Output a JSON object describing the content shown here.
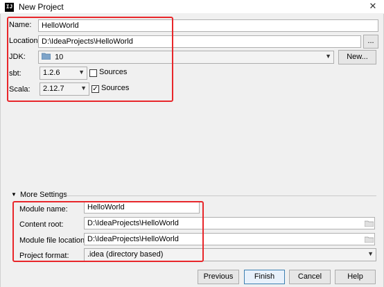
{
  "window": {
    "title": "New Project",
    "icon_label": "IJ",
    "close_label": "✕"
  },
  "form": {
    "name_label": "Name:",
    "name_value": "HelloWorld",
    "location_label": "Location:",
    "location_value": "D:\\IdeaProjects\\HelloWorld",
    "browse_label": "...",
    "jdk_label": "JDK:",
    "jdk_value": "10",
    "new_button_label": "New...",
    "sbt_label": "sbt:",
    "sbt_value": "1.2.6",
    "sbt_sources_label": "Sources",
    "sbt_sources_checked": false,
    "scala_label": "Scala:",
    "scala_value": "2.12.7",
    "scala_sources_label": "Sources",
    "scala_sources_checked": true
  },
  "more_settings": {
    "header_label": "More Settings",
    "module_name_label": "Module name:",
    "module_name_value": "HelloWorld",
    "content_root_label": "Content root:",
    "content_root_value": "D:\\IdeaProjects\\HelloWorld",
    "module_file_location_label": "Module file location:",
    "module_file_location_value": "D:\\IdeaProjects\\HelloWorld",
    "project_format_label": "Project format:",
    "project_format_value": ".idea (directory based)"
  },
  "footer": {
    "previous_label": "Previous",
    "finish_label": "Finish",
    "cancel_label": "Cancel",
    "help_label": "Help"
  },
  "colors": {
    "highlight_box": "#e8262a",
    "dialog_bg": "#f0f0f0"
  }
}
